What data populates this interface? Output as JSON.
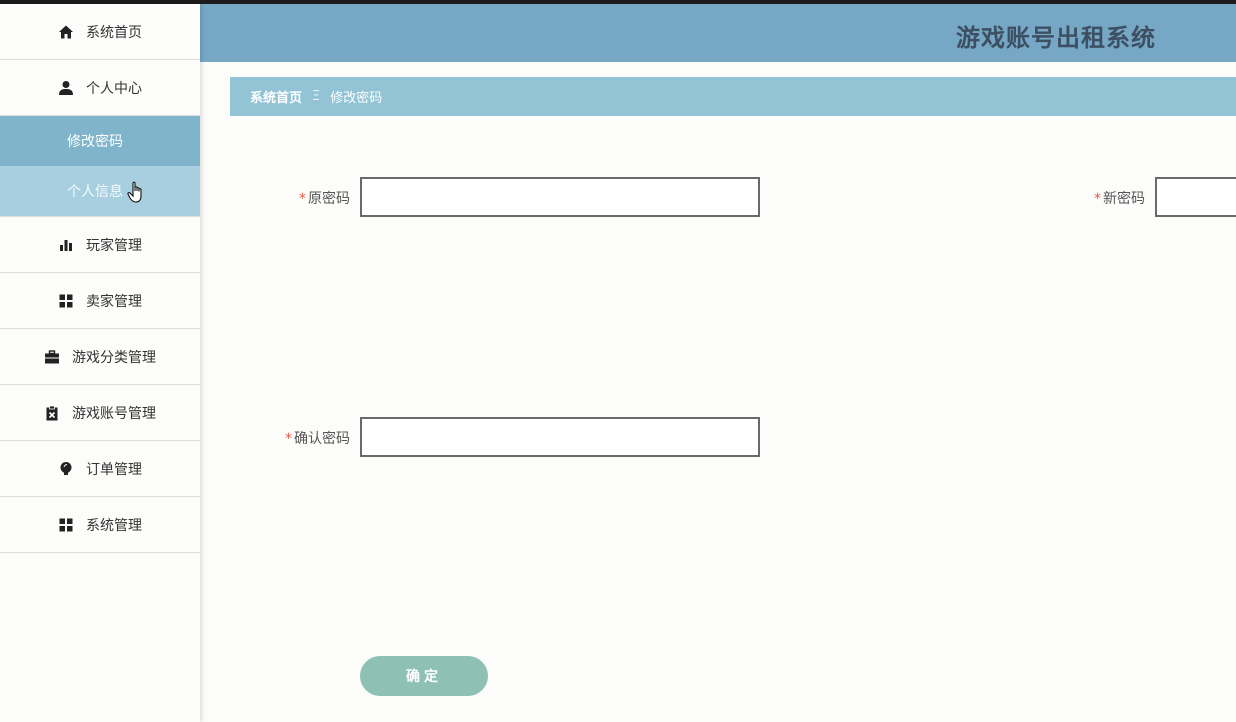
{
  "header": {
    "title": "游戏账号出租系统"
  },
  "sidebar": {
    "items": [
      {
        "label": "系统首页",
        "icon": "home-icon"
      },
      {
        "label": "个人中心",
        "icon": "user-icon"
      },
      {
        "label": "玩家管理",
        "icon": "bar-chart-icon"
      },
      {
        "label": "卖家管理",
        "icon": "grid-icon"
      },
      {
        "label": "游戏分类管理",
        "icon": "briefcase-icon"
      },
      {
        "label": "游戏账号管理",
        "icon": "clipboard-icon"
      },
      {
        "label": "订单管理",
        "icon": "lightbulb-icon"
      },
      {
        "label": "系统管理",
        "icon": "grid-icon"
      }
    ],
    "subitems": [
      {
        "label": "修改密码",
        "state": "active"
      },
      {
        "label": "个人信息",
        "state": "hover"
      }
    ]
  },
  "breadcrumb": {
    "home": "系统首页",
    "separator": "Ξ",
    "current": "修改密码"
  },
  "form": {
    "required_mark": "*",
    "old_password_label": "原密码",
    "new_password_label": "新密码",
    "confirm_password_label": "确认密码",
    "old_password_value": "",
    "new_password_value": "",
    "confirm_password_value": "",
    "submit_label": "确定"
  },
  "colors": {
    "header_bg": "#76a8c6",
    "breadcrumb_bg": "#93c4d6",
    "submenu_bg": "#91c2d6",
    "button_bg": "#8ec0b4",
    "required": "#e05a4f"
  }
}
